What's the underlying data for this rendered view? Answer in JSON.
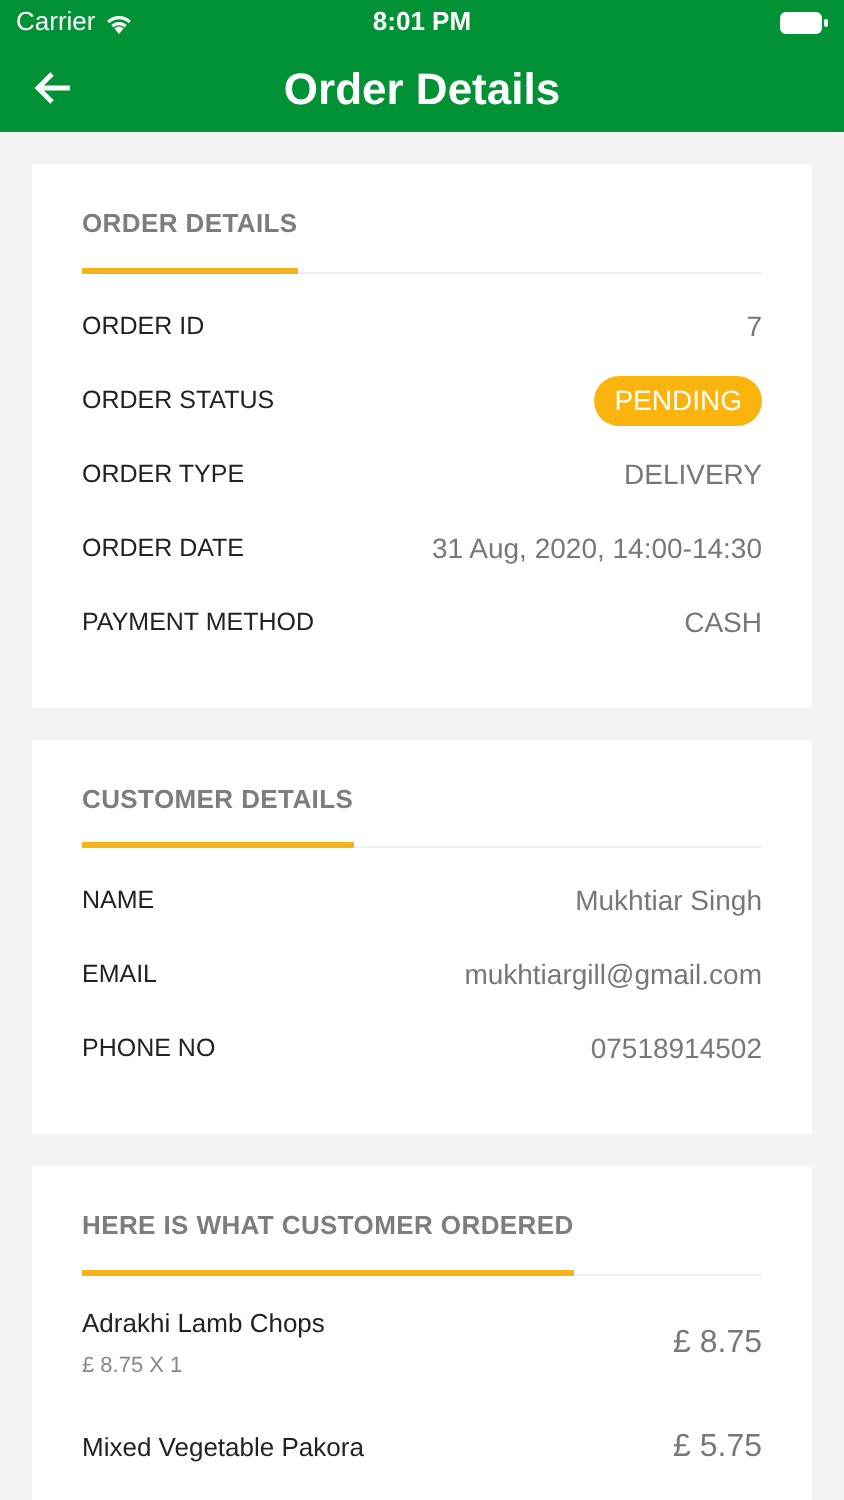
{
  "status_bar": {
    "carrier": "Carrier",
    "time": "8:01 PM"
  },
  "header": {
    "title": "Order Details"
  },
  "sections": [
    {
      "title": "ORDER DETAILS",
      "rows": [
        {
          "kind": "text",
          "label": "ORDER ID",
          "value": "7"
        },
        {
          "kind": "badge",
          "label": "ORDER STATUS",
          "value": "PENDING"
        },
        {
          "kind": "text",
          "label": "ORDER TYPE",
          "value": "DELIVERY"
        },
        {
          "kind": "text",
          "label": "ORDER DATE",
          "value": "31 Aug, 2020, 14:00-14:30"
        },
        {
          "kind": "text",
          "label": "PAYMENT METHOD",
          "value": "CASH"
        }
      ]
    },
    {
      "title": "CUSTOMER DETAILS",
      "rows": [
        {
          "kind": "text",
          "label": "NAME",
          "value": "Mukhtiar Singh"
        },
        {
          "kind": "text",
          "label": "EMAIL",
          "value": "mukhtiargill@gmail.com"
        },
        {
          "kind": "text",
          "label": "PHONE NO",
          "value": "07518914502"
        }
      ]
    }
  ],
  "order_items": {
    "title": "HERE IS WHAT CUSTOMER ORDERED",
    "items": [
      {
        "name": "Adrakhi Lamb Chops",
        "unit": "£ 8.75 X 1",
        "price": "£ 8.75"
      },
      {
        "name": "Mixed Vegetable Pakora",
        "price": "£ 5.75"
      }
    ]
  }
}
